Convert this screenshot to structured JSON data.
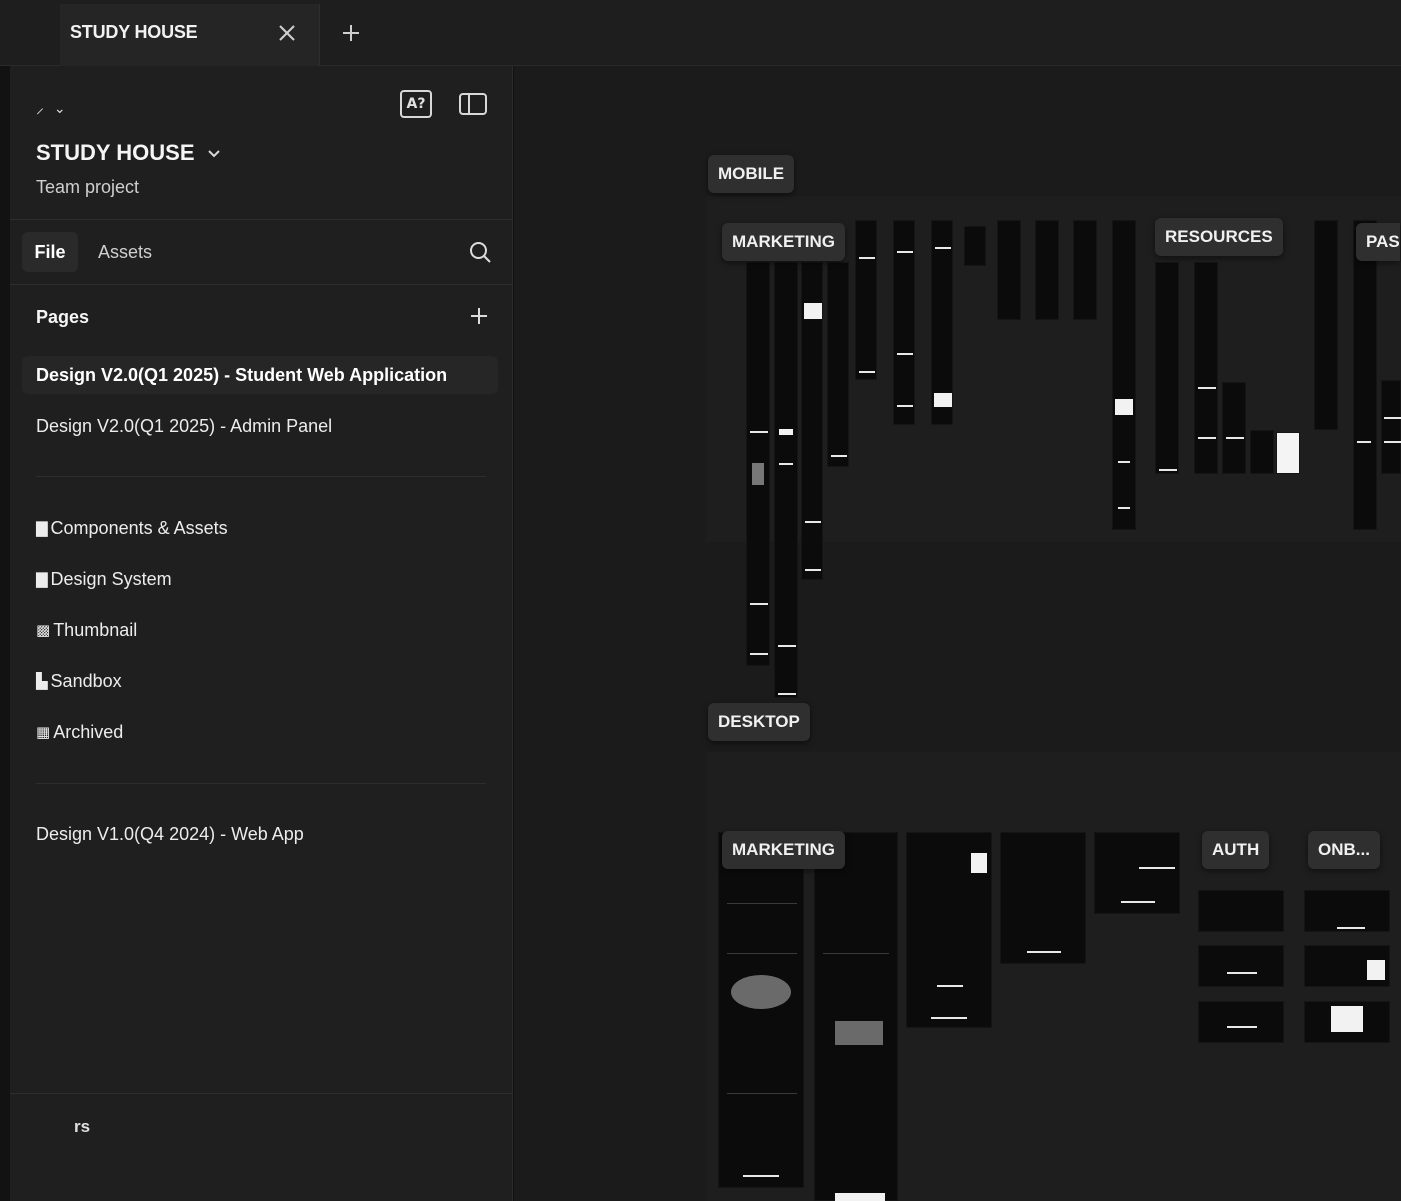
{
  "tabbar": {
    "active_tab": "STUDY HOUSE"
  },
  "sidebar": {
    "menu_glyph": "⌄",
    "ai_label": "A?",
    "project": {
      "title": "STUDY HOUSE",
      "subtitle": "Team project"
    },
    "tabs": [
      {
        "label": "File"
      },
      {
        "label": "Assets"
      }
    ],
    "pages_heading": "Pages",
    "pages": [
      {
        "label": "Design V2.0(Q1 2025) - Student Web Application",
        "selected": true
      },
      {
        "label": "Design V2.0(Q1 2025) - Admin Panel"
      },
      {
        "label": "Components & Assets",
        "icon": "📄"
      },
      {
        "label": "Design System",
        "icon": "📘"
      },
      {
        "label": "Thumbnail",
        "icon": "🖼"
      },
      {
        "label": "Sandbox",
        "icon": "🏗"
      },
      {
        "label": "Archived",
        "icon": "🗃"
      },
      {
        "label": "Design V1.0(Q4 2024) - Web App"
      }
    ],
    "footer": "rs"
  },
  "canvas": {
    "sections": {
      "mobile": "MOBILE",
      "desktop": "DESKTOP"
    },
    "groups": {
      "mobile_marketing": "MARKETING",
      "resources": "RESOURCES",
      "pas": "PAS",
      "desktop_marketing": "MARKETING",
      "auth": "AUTH",
      "onb": "ONB..."
    }
  },
  "colors": {
    "background": "#121212",
    "sidebar": "#1f1f1f",
    "canvas": "#1b1b1b",
    "label_bg": "#2f2f2f"
  }
}
